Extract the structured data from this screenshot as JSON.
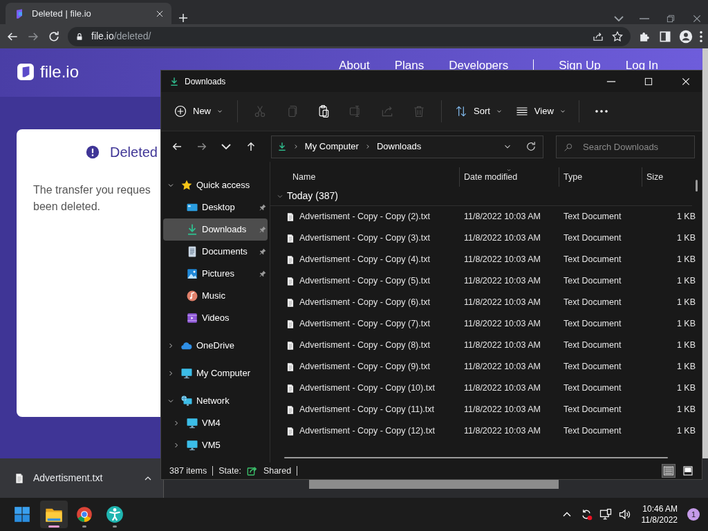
{
  "browser": {
    "tab": {
      "title": "Deleted | file.io"
    },
    "address": {
      "host": "file.io",
      "path": "/deleted/"
    }
  },
  "site": {
    "logo": "file.io",
    "nav": [
      {
        "label": "About"
      },
      {
        "label": "Plans"
      },
      {
        "label": "Developers"
      },
      {
        "label": "Sign Up"
      },
      {
        "label": "Log In"
      }
    ],
    "card": {
      "title": "Deleted",
      "lines": [
        "The transfer you reques",
        "been deleted."
      ]
    }
  },
  "download_bar": {
    "file": "Advertisment.txt"
  },
  "explorer": {
    "title": "Downloads",
    "toolbar": [
      {
        "kind": "new",
        "label": "New",
        "dropdown": true,
        "disabled": false
      },
      {
        "kind": "cut",
        "disabled": true
      },
      {
        "kind": "copy",
        "disabled": true
      },
      {
        "kind": "paste",
        "disabled": false
      },
      {
        "kind": "rename",
        "disabled": true
      },
      {
        "kind": "share",
        "disabled": true
      },
      {
        "kind": "delete",
        "disabled": true
      },
      {
        "kind": "sort",
        "label": "Sort",
        "dropdown": true,
        "disabled": false
      },
      {
        "kind": "view",
        "label": "View",
        "dropdown": true,
        "disabled": false
      },
      {
        "kind": "more",
        "disabled": false
      }
    ],
    "breadcrumb": [
      "My Computer",
      "Downloads"
    ],
    "search": {
      "placeholder": "Search Downloads"
    },
    "nav_tree": [
      {
        "label": "Quick access",
        "expanded": true,
        "selected": false,
        "children": [
          {
            "label": "Desktop",
            "pinned": true,
            "selected": false
          },
          {
            "label": "Downloads",
            "pinned": true,
            "selected": true
          },
          {
            "label": "Documents",
            "pinned": true,
            "selected": false
          },
          {
            "label": "Pictures",
            "pinned": true,
            "selected": false
          },
          {
            "label": "Music",
            "pinned": false,
            "selected": false
          },
          {
            "label": "Videos",
            "pinned": false,
            "selected": false
          }
        ]
      },
      {
        "label": "OneDrive",
        "expanded": false,
        "selected": false
      },
      {
        "label": "My Computer",
        "expanded": false,
        "selected": false
      },
      {
        "label": "Network",
        "expanded": true,
        "selected": false,
        "children": [
          {
            "label": "VM4",
            "expanded": false,
            "selected": false
          },
          {
            "label": "VM5",
            "expanded": false,
            "selected": false
          }
        ]
      }
    ],
    "columns": [
      {
        "label": "Name",
        "sorted": false
      },
      {
        "label": "Date modified",
        "sorted": true
      },
      {
        "label": "Type",
        "sorted": false
      },
      {
        "label": "Size",
        "sorted": false
      }
    ],
    "group": {
      "label": "Today (387)",
      "expanded": true
    },
    "rows": [
      {
        "name": "Advertisment - Copy - Copy (2).txt",
        "date": "11/8/2022 10:03 AM",
        "type": "Text Document",
        "size": "1 KB"
      },
      {
        "name": "Advertisment - Copy - Copy (3).txt",
        "date": "11/8/2022 10:03 AM",
        "type": "Text Document",
        "size": "1 KB"
      },
      {
        "name": "Advertisment - Copy - Copy (4).txt",
        "date": "11/8/2022 10:03 AM",
        "type": "Text Document",
        "size": "1 KB"
      },
      {
        "name": "Advertisment - Copy - Copy (5).txt",
        "date": "11/8/2022 10:03 AM",
        "type": "Text Document",
        "size": "1 KB"
      },
      {
        "name": "Advertisment - Copy - Copy (6).txt",
        "date": "11/8/2022 10:03 AM",
        "type": "Text Document",
        "size": "1 KB"
      },
      {
        "name": "Advertisment - Copy - Copy (7).txt",
        "date": "11/8/2022 10:03 AM",
        "type": "Text Document",
        "size": "1 KB"
      },
      {
        "name": "Advertisment - Copy - Copy (8).txt",
        "date": "11/8/2022 10:03 AM",
        "type": "Text Document",
        "size": "1 KB"
      },
      {
        "name": "Advertisment - Copy - Copy (9).txt",
        "date": "11/8/2022 10:03 AM",
        "type": "Text Document",
        "size": "1 KB"
      },
      {
        "name": "Advertisment - Copy - Copy (10).txt",
        "date": "11/8/2022 10:03 AM",
        "type": "Text Document",
        "size": "1 KB"
      },
      {
        "name": "Advertisment - Copy - Copy (11).txt",
        "date": "11/8/2022 10:03 AM",
        "type": "Text Document",
        "size": "1 KB"
      },
      {
        "name": "Advertisment - Copy - Copy (12).txt",
        "date": "11/8/2022 10:03 AM",
        "type": "Text Document",
        "size": "1 KB"
      }
    ],
    "status": {
      "count": "387 items",
      "state_label": "State:",
      "state": "Shared"
    },
    "views": [
      {
        "kind": "details",
        "selected": true
      },
      {
        "kind": "tiles",
        "selected": false
      }
    ]
  },
  "taskbar": {
    "apps": [
      {
        "kind": "start",
        "running": false,
        "selected": false
      },
      {
        "kind": "files",
        "running": true,
        "selected": true
      },
      {
        "kind": "browser",
        "running": true,
        "selected": false
      },
      {
        "kind": "accessibility",
        "running": true,
        "selected": false
      }
    ],
    "clock": {
      "time": "10:46 AM",
      "date": "11/8/2022"
    },
    "notifications": "1"
  }
}
